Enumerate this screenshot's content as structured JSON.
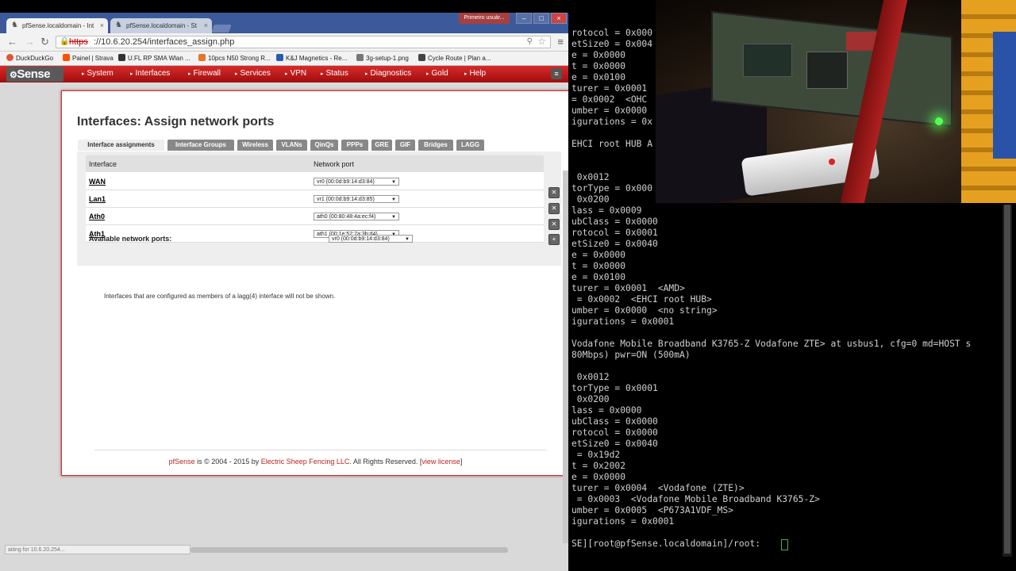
{
  "browser": {
    "tabs": [
      {
        "title": "pfSense.localdomain - Int",
        "active": true
      },
      {
        "title": "pfSense.localdomain - St",
        "active": false
      }
    ],
    "window_user_label": "Primeiro usuár...",
    "url_scheme": "https",
    "url_rest": "://10.6.20.254/interfaces_assign.php",
    "bookmarks": [
      "DuckDuckGo",
      "Painel | Strava",
      "U.FL RP SMA Wlan ...",
      "10pcs N50 Strong R...",
      "K&J Magnetics - Re...",
      "3g-setup-1.png",
      "Cycle Route | Plan a..."
    ],
    "status_text": "aiting for 10.6.20.254..."
  },
  "pfsense": {
    "logo": "Sense",
    "nav": [
      "System",
      "Interfaces",
      "Firewall",
      "Services",
      "VPN",
      "Status",
      "Diagnostics",
      "Gold",
      "Help"
    ],
    "page_title": "Interfaces: Assign network ports",
    "tabs": [
      "Interface assignments",
      "Interface Groups",
      "Wireless",
      "VLANs",
      "QinQs",
      "PPPs",
      "GRE",
      "GIF",
      "Bridges",
      "LAGG"
    ],
    "table_headers": [
      "Interface",
      "Network port"
    ],
    "rows": [
      {
        "name": "WAN",
        "port": "vr0 (00:0d:b9:14:d3:84)"
      },
      {
        "name": "Lan1",
        "port": "vr1 (00:0d:b9:14:d3:85)"
      },
      {
        "name": "Ath0",
        "port": "ath0 (00:80:48:4a:ec:f4)"
      },
      {
        "name": "Ath1",
        "port": "ath1 (00:1e:52:7a:3b:d4)"
      }
    ],
    "available_label": "Available network ports:",
    "available_value": "vr0 (00:0d:b9:14:d3:84)",
    "note": "Interfaces that are configured as members of a lagg(4) interface will not be shown.",
    "footer": {
      "brand": "pfSense",
      "text1": " is © 2004 - 2015 by ",
      "company": "Electric Sheep Fencing LLC",
      "text2": ". All Rights Reserved. [",
      "license": "view license",
      "text3": "]"
    }
  },
  "terminal": {
    "lines": [
      "rotocol = 0x000",
      "etSize0 = 0x004",
      "e = 0x0000",
      "t = 0x0000",
      "e = 0x0100",
      "turer = 0x0001",
      "= 0x0002  <OHC",
      "umber = 0x0000",
      "igurations = 0x",
      "",
      "EHCI root HUB A",
      "",
      "",
      " 0x0012",
      "torType = 0x000",
      " 0x0200",
      "lass = 0x0009",
      "ubClass = 0x0000",
      "rotocol = 0x0001",
      "etSize0 = 0x0040",
      "e = 0x0000",
      "t = 0x0000",
      "e = 0x0100",
      "turer = 0x0001  <AMD>",
      " = 0x0002  <EHCI root HUB>",
      "umber = 0x0000  <no string>",
      "igurations = 0x0001",
      "",
      "Vodafone Mobile Broadband K3765-Z Vodafone ZTE> at usbus1, cfg=0 md=HOST s",
      "80Mbps) pwr=ON (500mA)",
      "",
      " 0x0012",
      "torType = 0x0001",
      " 0x0200",
      "lass = 0x0000",
      "ubClass = 0x0000",
      "rotocol = 0x0000",
      "etSize0 = 0x0040",
      " = 0x19d2",
      "t = 0x2002",
      "e = 0x0000",
      "turer = 0x0004  <Vodafone (ZTE)>",
      " = 0x0003  <Vodafone Mobile Broadband K3765-Z>",
      "umber = 0x0005  <P673A1VDF_MS>",
      "igurations = 0x0001",
      "",
      "SE][root@pfSense.localdomain]/root: "
    ]
  },
  "colors": {
    "pfsense_red": "#c21a1a",
    "terminal_bg": "#000000",
    "terminal_fg": "#d0d0d0",
    "chrome_frame": "#3c5a9a"
  }
}
